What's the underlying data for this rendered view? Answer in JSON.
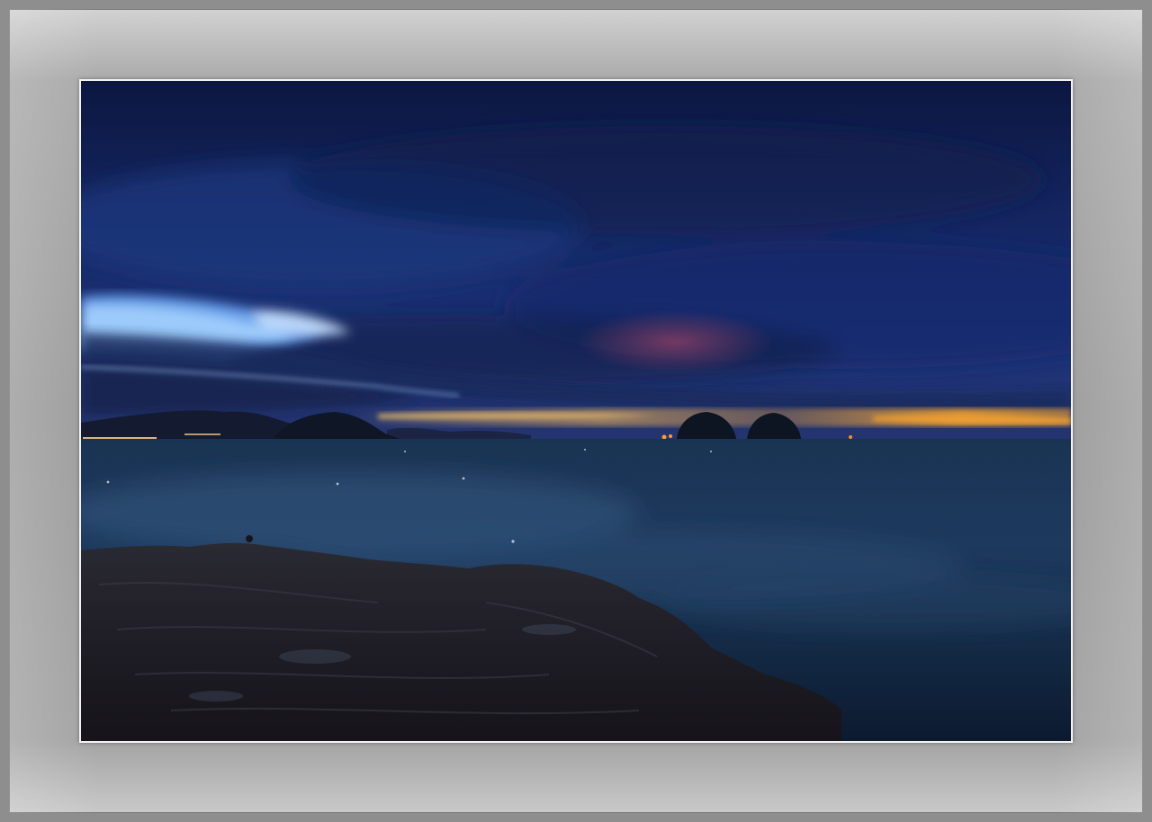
{
  "frame": {
    "mat_color": "#a3a3a3",
    "outer_color": "#8e8e8e",
    "inner_border_color": "#f2f2f2"
  },
  "photo": {
    "subject": "night-seascape",
    "palette": {
      "sky_top": "#0f1d4a",
      "sky_mid": "#1a2f78",
      "cloud_band_light": "#7fb6ff",
      "horizon_glow": "#f2a23a",
      "sea": "#142a4a",
      "rocks": "#1c1b22"
    }
  }
}
